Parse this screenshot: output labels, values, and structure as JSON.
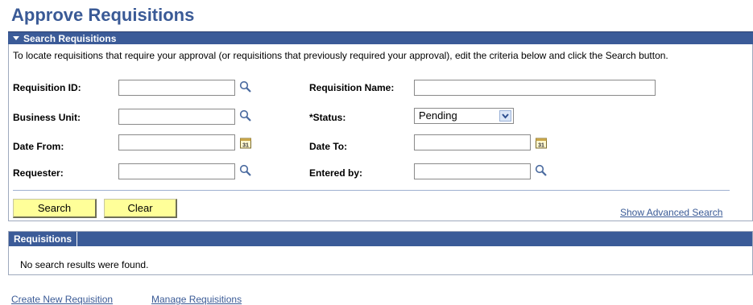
{
  "page": {
    "title": "Approve Requisitions"
  },
  "search_section": {
    "header": "Search Requisitions",
    "instructions": "To locate requisitions that require your approval (or requisitions that previously required your approval), edit the criteria below and click the Search button.",
    "fields": {
      "requisition_id": {
        "label": "Requisition ID:",
        "value": ""
      },
      "requisition_name": {
        "label": "Requisition Name:",
        "value": ""
      },
      "business_unit": {
        "label": "Business Unit:",
        "value": ""
      },
      "status": {
        "label": "*Status:",
        "value": "Pending"
      },
      "date_from": {
        "label": "Date From:",
        "value": ""
      },
      "date_to": {
        "label": "Date To:",
        "value": ""
      },
      "requester": {
        "label": "Requester:",
        "value": ""
      },
      "entered_by": {
        "label": "Entered by:",
        "value": ""
      }
    },
    "buttons": {
      "search": "Search",
      "clear": "Clear"
    },
    "advanced_link": "Show Advanced Search"
  },
  "results": {
    "header": "Requisitions",
    "empty_message": "No search results were found."
  },
  "footer_links": {
    "create": "Create New Requisition",
    "manage": "Manage Requisitions"
  },
  "colors": {
    "accent": "#3b5b98",
    "button": "#ffff99",
    "link": "#3a5a96"
  }
}
